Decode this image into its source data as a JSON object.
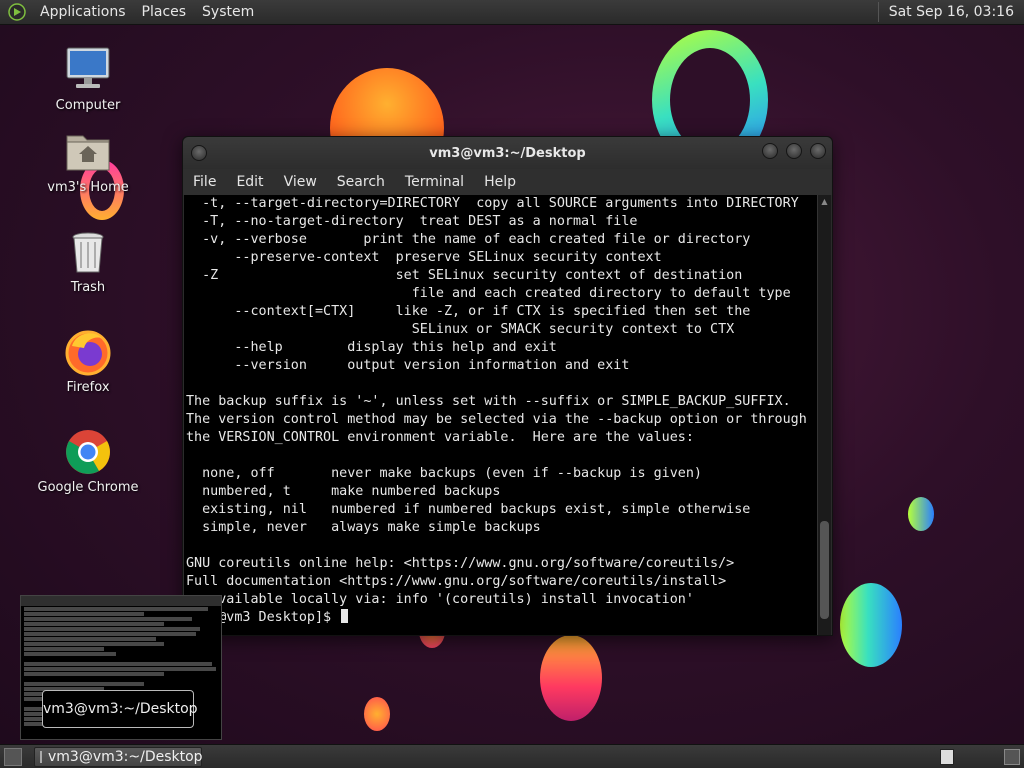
{
  "top_panel": {
    "menus": [
      "Applications",
      "Places",
      "System"
    ],
    "clock": "Sat Sep 16, 03:16"
  },
  "desktop_icons": [
    {
      "label": "Computer",
      "icon": "computer-icon"
    },
    {
      "label": "vm3's Home",
      "icon": "home-folder-icon"
    },
    {
      "label": "Trash",
      "icon": "trash-icon"
    },
    {
      "label": "Firefox",
      "icon": "firefox-icon"
    },
    {
      "label": "Google Chrome",
      "icon": "chrome-icon"
    }
  ],
  "window": {
    "title": "vm3@vm3:~/Desktop",
    "menus": [
      "File",
      "Edit",
      "View",
      "Search",
      "Terminal",
      "Help"
    ],
    "terminal_lines": [
      "  -t, --target-directory=DIRECTORY  copy all SOURCE arguments into DIRECTORY",
      "  -T, --no-target-directory  treat DEST as a normal file",
      "  -v, --verbose       print the name of each created file or directory",
      "      --preserve-context  preserve SELinux security context",
      "  -Z                      set SELinux security context of destination",
      "                            file and each created directory to default type",
      "      --context[=CTX]     like -Z, or if CTX is specified then set the",
      "                            SELinux or SMACK security context to CTX",
      "      --help        display this help and exit",
      "      --version     output version information and exit",
      "",
      "The backup suffix is '~', unless set with --suffix or SIMPLE_BACKUP_SUFFIX.",
      "The version control method may be selected via the --backup option or through",
      "the VERSION_CONTROL environment variable.  Here are the values:",
      "",
      "  none, off       never make backups (even if --backup is given)",
      "  numbered, t     make numbered backups",
      "  existing, nil   numbered if numbered backups exist, simple otherwise",
      "  simple, never   always make simple backups",
      "",
      "GNU coreutils online help: <https://www.gnu.org/software/coreutils/>",
      "Full documentation <https://www.gnu.org/software/coreutils/install>",
      "or available locally via: info '(coreutils) install invocation'"
    ],
    "prompt": "[vm3@vm3 Desktop]$ "
  },
  "preview": {
    "tooltip": "vm3@vm3:~/Desktop"
  },
  "taskbar": {
    "task_label": "vm3@vm3:~/Desktop"
  }
}
